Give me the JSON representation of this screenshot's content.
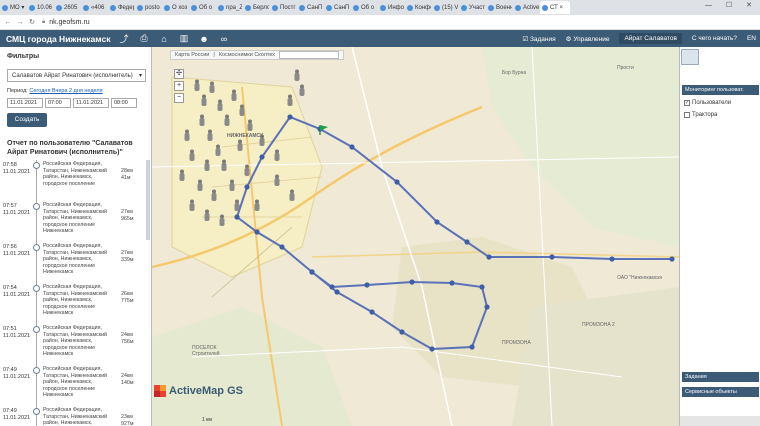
{
  "browser": {
    "tabs": [
      "МО ▾",
      "10.06",
      "2605",
      "«406 ⌄",
      "Федер",
      "posto",
      "О хоз",
      "Об о",
      "npa_Z",
      "Берло",
      "Постг",
      "СанП",
      "СанП",
      "Об о",
      "Инфо",
      "Конфо",
      "(15) V",
      "Участ",
      "Военн",
      "Active",
      "СТ ×"
    ],
    "url": "nk.geofsm.ru",
    "win_controls": "— ☐ ✕"
  },
  "header": {
    "title": "СМЦ города Нижнекамск",
    "tasks": "Задания",
    "management": "Управление",
    "user": "Айрат Салаватов",
    "start": "С чего начать?",
    "lang": "EN"
  },
  "filters": {
    "title": "Фильтры",
    "user_select": "Салаватов Айрат Ринатович (исполнитель)",
    "period_label": "Период:",
    "period_links": "Сегодня Вчера 2 дня неделя",
    "date_from": "11.01.2021",
    "time_from": "07:00",
    "date_to": "11.01.2021",
    "time_to": "08:00",
    "create_label": "Создать"
  },
  "report": {
    "title": "Отчет по пользователю \"Салаватов Айрат Ринатович (исполнитель)\"",
    "entries": [
      {
        "time": "07:58",
        "date": "11.01.2021",
        "place": "Российская Федерация, Татарстан, Нижнекамский район, Нижнекамск, городское поселение",
        "dist": "28км 41м"
      },
      {
        "time": "07:57",
        "date": "11.01.2021",
        "place": "Российская Федерация, Татарстан, Нижнекамский район, Нижнекамск, городское поселение Нижнекамск",
        "dist": "27км 965м"
      },
      {
        "time": "07:56",
        "date": "11.01.2021",
        "place": "Российская Федерация, Татарстан, Нижнекамский район, Нижнекамск, городское поселение Нижнекамск",
        "dist": "27км 339м"
      },
      {
        "time": "07:54",
        "date": "11.01.2021",
        "place": "Российская Федерация, Татарстан, Нижнекамский район, Нижнекамск, городское поселение Нижнекамск",
        "dist": "26км 775м"
      },
      {
        "time": "07:51",
        "date": "11.01.2021",
        "place": "Российская Федерация, Татарстан, Нижнекамский район, Нижнекамск, городское поселение Нижнекамск",
        "dist": "24км 756м"
      },
      {
        "time": "07:49",
        "date": "11.01.2021",
        "place": "Российская Федерация, Татарстан, Нижнекамский район, Нижнекамск, городское поселение Нижнекамск",
        "dist": "24км 140м"
      },
      {
        "time": "07:49",
        "date": "11.01.2021",
        "place": "Российская Федерация, Татарстан, Нижнекамский район, Нижнекамск, городское поселение",
        "dist": "23км 927м"
      }
    ]
  },
  "map": {
    "layer_maps": "Карта России",
    "layer_space": "Космоснимки Сколтех",
    "logo": "ActiveMap GS",
    "scale": "1 км",
    "places": {
      "nizhnekamsk": "НИЖНЕКАМСК",
      "prosti": "Прости",
      "promzona1": "ПРОМЗОНА",
      "promzona2": "ПРОМЗОНА 2",
      "stroitel": "ПОСЕЛОК Строителей",
      "oao": "ОАО \"Нижнекамскн",
      "bolsh": "Бор Бурна"
    },
    "route_color": "#5b72b8"
  },
  "right_panel": {
    "monitoring": "Мониторинг пользоват.",
    "users": "Пользователи",
    "users_checked": "✓",
    "tractors": "Трактора",
    "tasks": "Задания",
    "service": "Сервисные объекты"
  }
}
